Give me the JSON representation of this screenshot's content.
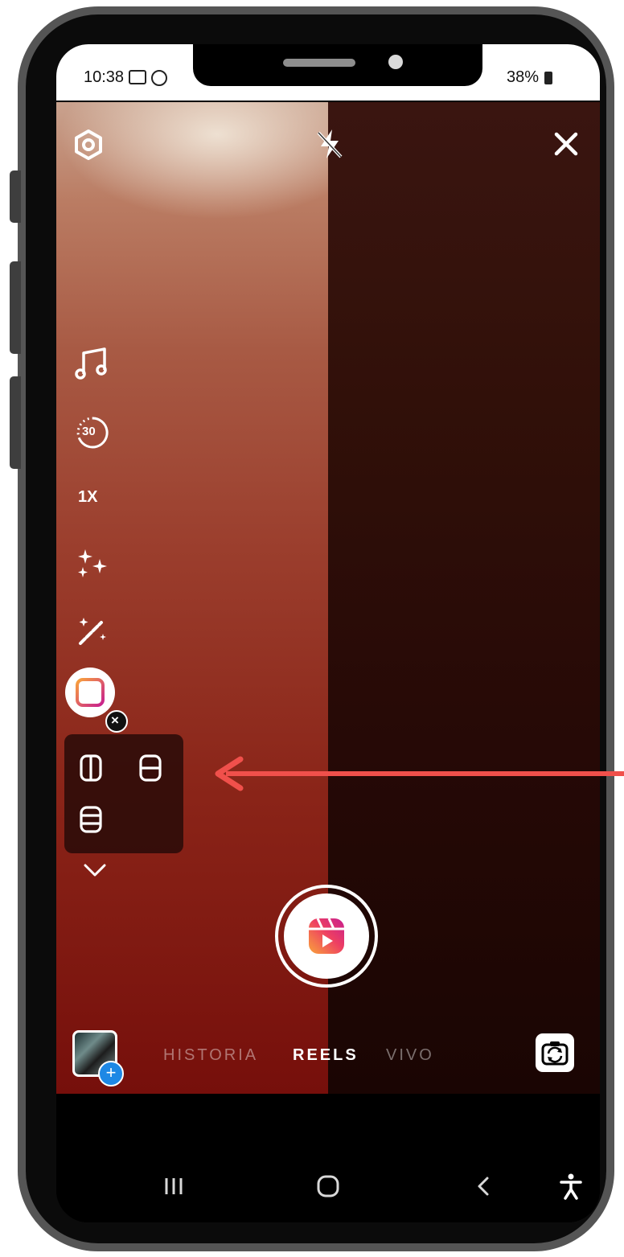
{
  "status_bar": {
    "time": "10:38",
    "battery": "38%"
  },
  "camera_toolbar": {
    "speed": "1X",
    "timer": "30"
  },
  "layout_close_glyph": "×",
  "modes": {
    "historia": "HISTORIA",
    "reels": "REELS",
    "vivo": "VIVO",
    "selected": "REELS"
  },
  "gallery_add_glyph": "+",
  "icons": {
    "settings": "settings-icon",
    "flash": "flash-off-icon",
    "close": "close-icon",
    "music": "music-icon",
    "timer": "timer-icon",
    "effects": "sparkles-icon",
    "touch_up": "magic-wand-icon",
    "layout": "layout-icon",
    "layout_options": [
      "layout-2-vertical-icon",
      "layout-2-horizontal-icon",
      "layout-3-rows-icon"
    ],
    "more": "chevron-down-icon",
    "record": "reels-icon",
    "flip": "flip-camera-icon",
    "nav": [
      "recent-apps-icon",
      "home-icon",
      "back-icon",
      "accessibility-icon"
    ]
  },
  "colors": {
    "arrow": "#f0504b",
    "reels_gradient_start": "#f9a33b",
    "reels_gradient_end": "#c71f8f",
    "gallery_add": "#1e88e5"
  }
}
